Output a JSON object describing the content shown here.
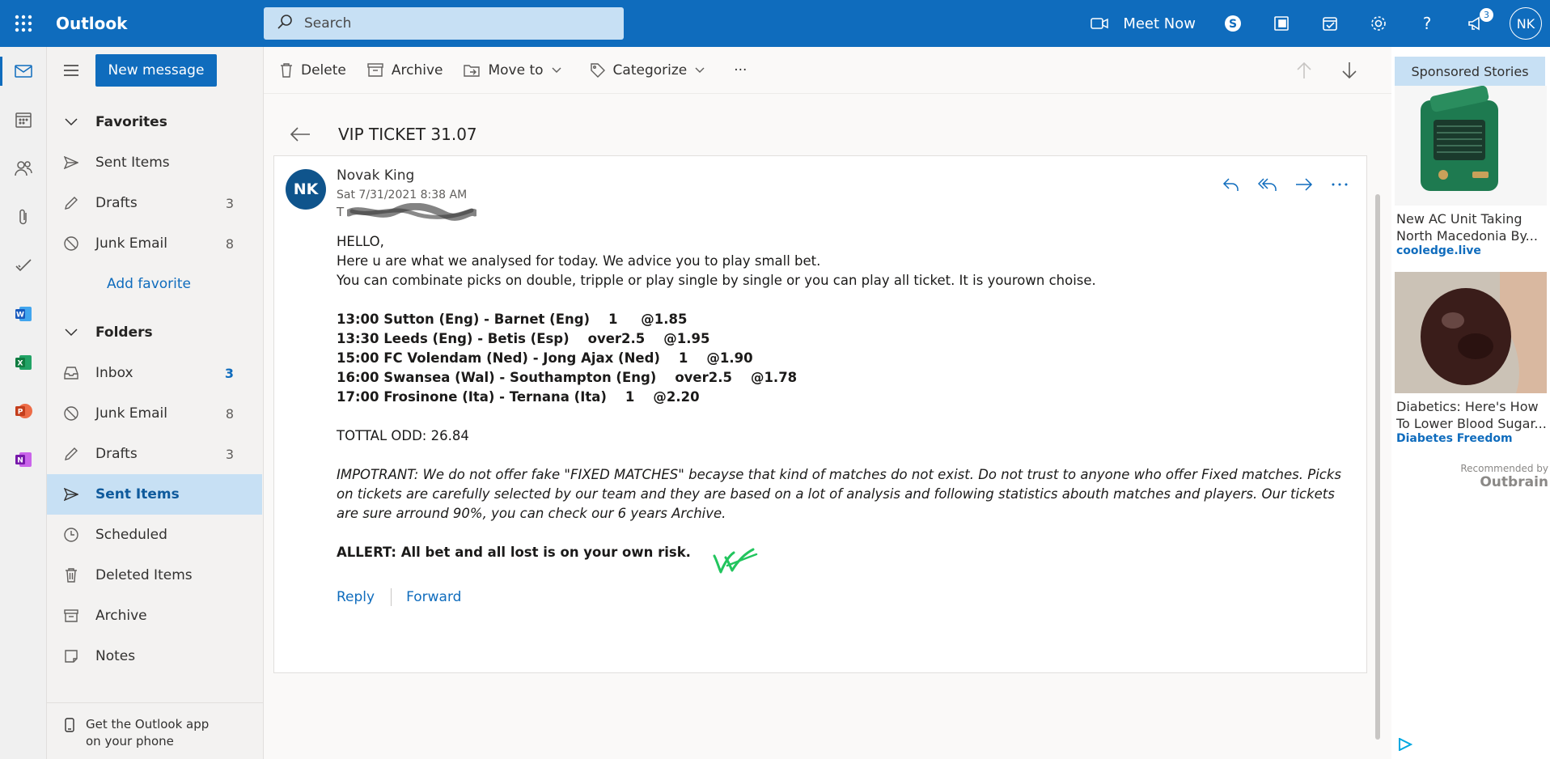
{
  "app": {
    "name": "Outlook"
  },
  "search": {
    "placeholder": "Search"
  },
  "header": {
    "meet_now": "Meet Now",
    "notifications_count": "3",
    "user_initials": "NK"
  },
  "nav": {
    "new_message": "New message",
    "favorites_label": "Favorites",
    "favorites": [
      {
        "label": "Sent Items",
        "count": ""
      },
      {
        "label": "Drafts",
        "count": "3"
      },
      {
        "label": "Junk Email",
        "count": "8"
      }
    ],
    "add_favorite": "Add favorite",
    "folders_label": "Folders",
    "folders": [
      {
        "label": "Inbox",
        "count": "3"
      },
      {
        "label": "Junk Email",
        "count": "8"
      },
      {
        "label": "Drafts",
        "count": "3"
      },
      {
        "label": "Sent Items",
        "count": ""
      },
      {
        "label": "Scheduled",
        "count": ""
      },
      {
        "label": "Deleted Items",
        "count": ""
      },
      {
        "label": "Archive",
        "count": ""
      },
      {
        "label": "Notes",
        "count": ""
      }
    ],
    "get_app_line1": "Get the Outlook app",
    "get_app_line2": "on your phone"
  },
  "toolbar": {
    "delete": "Delete",
    "archive": "Archive",
    "move_to": "Move to",
    "categorize": "Categorize",
    "more": "···"
  },
  "message": {
    "subject": "VIP TICKET 31.07",
    "sender_initials": "NK",
    "sender": "Novak King",
    "date": "Sat 7/31/2021 8:38 AM",
    "to_prefix": "T",
    "greeting": "HELLO,",
    "line1": "Here u are what we analysed for today. We advice you to play small bet.",
    "line2": "You can combinate picks on double, tripple or play single by single or you can play all ticket. It is yourown choise.",
    "picks": [
      "13:00 Sutton (Eng) - Barnet (Eng)    1     @1.85",
      "13:30 Leeds (Eng) - Betis (Esp)    over2.5    @1.95",
      "15:00 FC Volendam (Ned) - Jong Ajax (Ned)    1    @1.90",
      "16:00 Swansea (Wal) - Southampton (Eng)    over2.5    @1.78",
      "17:00 Frosinone (Ita) - Ternana (Ita)    1    @2.20"
    ],
    "total": "TOTTAL ODD: 26.84",
    "important": "IMPOTRANT: We do not offer fake \"FIXED MATCHES\" becayse that kind of matches do not exist. Do not trust to anyone who offer Fixed matches. Picks on tickets are carefully selected by our team and they are based on a lot of analysis and following statistics abouth matches and players. Our tickets are sure arround 90%, you can check our 6 years Archive.",
    "alert": "ALLERT: All bet and all lost is on your own risk.",
    "reply": "Reply",
    "forward": "Forward"
  },
  "ads": {
    "header": "Sponsored Stories",
    "items": [
      {
        "title": "New AC Unit Taking North Macedonia By...",
        "source": "cooledge.live"
      },
      {
        "title": "Diabetics: Here's How To Lower Blood Sugar...",
        "source": "Diabetes Freedom"
      }
    ],
    "recommended_by": "Recommended by",
    "outbrain": "Outbrain"
  },
  "colors": {
    "brand": "#0f6cbd",
    "selected": "#c7e0f4",
    "avatar": "#0f548c",
    "signature": "#22c55e"
  }
}
